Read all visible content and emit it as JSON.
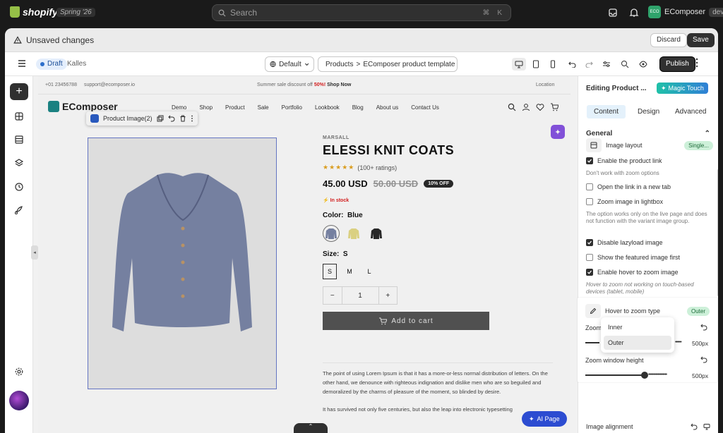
{
  "topbar": {
    "logo_text": "shopify",
    "edition": "Spring '26",
    "search_placeholder": "Search",
    "shortcut": "⌘ K",
    "store_avatar": "ECO",
    "store_name": "EComposer",
    "store_tag": "dev"
  },
  "unsaved": {
    "message": "Unsaved changes",
    "discard_label": "Discard",
    "save_label": "Save"
  },
  "toolbar": {
    "status_label": "Draft",
    "theme_name": "Kalles",
    "locale_select": "Default",
    "breadcrumb_root": "Products",
    "breadcrumb_sep": ">",
    "template_name": "EComposer product template",
    "publish_label": "Publish"
  },
  "storefront": {
    "announcement_phone": "+01 23456788",
    "announcement_email": "support@ecomposer.io",
    "announcement_text": "Summer sale discount off",
    "announcement_discount": "50%!",
    "announcement_cta": "Shop Now",
    "announcement_location": "Location",
    "brand": "EComposer",
    "menu": [
      "Demo",
      "Shop",
      "Product",
      "Sale",
      "Portfolio",
      "Lookbook",
      "Blog",
      "About us",
      "Contact Us"
    ],
    "element_toolbar_label": "Product Image(2)",
    "vendor": "MARSALL",
    "title": "ELESSI KNIT COATS",
    "stars": "★★★★★",
    "rating_text": "(100+ ratings)",
    "price": "45.00 USD",
    "compare_price": "50.00 USD",
    "discount_badge": "10% OFF",
    "stock": "In stock",
    "color_label": "Color:",
    "color_value": "Blue",
    "size_label": "Size:",
    "size_value": "S",
    "sizes": [
      "S",
      "M",
      "L"
    ],
    "qty_minus": "−",
    "qty_value": "1",
    "qty_plus": "+",
    "add_to_cart": "Add to cart",
    "description_1": "The point of using Lorem Ipsum is that it has a more-or-less normal distribution of letters. On the other hand, we denounce with righteous indignation and dislike men who are so beguiled and demoralized by the charms of pleasure of the moment, so blinded by desire.",
    "description_2": "It has survived not only five centuries, but also the leap into electronic typesetting",
    "ai_page_label": "AI Page"
  },
  "panel": {
    "editing_title": "Editing Product ...",
    "magic_label": "Magic Touch",
    "tabs": [
      "Content",
      "Design",
      "Advanced"
    ],
    "section_title": "General",
    "image_layout_label": "Image layout",
    "image_layout_value": "Single...",
    "enable_link_label": "Enable the product link",
    "enable_link_note": "Don't work with zoom options",
    "new_tab_label": "Open the link in a new tab",
    "lightbox_label": "Zoom image in lightbox",
    "lightbox_note": "The option works only on the live page and does not function with the variant image group.",
    "lazyload_label": "Disable lazyload image",
    "featured_label": "Show the featured image first",
    "hover_zoom_label": "Enable hover to zoom image",
    "hover_zoom_note": "Hover to zoom not working on touch-based devices (tablet, mobile)",
    "zoom_type_label": "Hover to zoom type",
    "zoom_type_value": "Outer",
    "zoom_width_label": "Zoom",
    "zoom_width_value": "500px",
    "zoom_height_label": "Zoom window height",
    "zoom_height_value": "500px",
    "dropdown_options": [
      "Inner",
      "Outer"
    ],
    "image_alignment_label": "Image alignment"
  },
  "colors": {
    "accent": "#303030",
    "selection_blue": "#e4f1fb",
    "magic_gradient_start": "#20c1a8",
    "sale_red": "#e02020"
  }
}
